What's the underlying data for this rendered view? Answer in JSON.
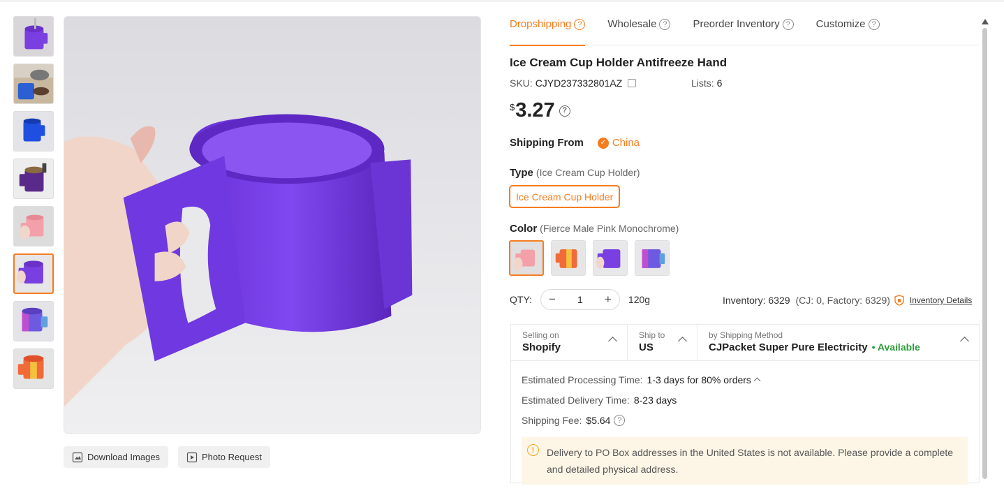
{
  "tabs": [
    {
      "label": "Dropshipping"
    },
    {
      "label": "Wholesale"
    },
    {
      "label": "Preorder Inventory"
    },
    {
      "label": "Customize"
    }
  ],
  "product": {
    "title": "Ice Cream Cup Holder Antifreeze Hand",
    "sku_label": "SKU:",
    "sku": "CJYD237332801AZ",
    "lists_label": "Lists:",
    "lists": "6",
    "currency": "$",
    "price": "3.27"
  },
  "shipping_from": {
    "label": "Shipping From",
    "value": "China"
  },
  "type": {
    "label": "Type",
    "selected_text": "(Ice Cream Cup Holder)",
    "option": "Ice Cream Cup Holder"
  },
  "color": {
    "label": "Color",
    "selected_text": "(Fierce Male Pink Monochrome)"
  },
  "qty": {
    "label": "QTY:",
    "value": "1",
    "weight": "120g"
  },
  "inventory": {
    "text": "Inventory: 6329",
    "detail": "(CJ: 0, Factory: 6329)",
    "link": "Inventory Details"
  },
  "shipping": {
    "selling_on_label": "Selling on",
    "selling_on": "Shopify",
    "ship_to_label": "Ship to",
    "ship_to": "US",
    "method_label": "by Shipping Method",
    "method": "CJPacket Super Pure Electricity",
    "availability": "• Available",
    "processing_label": "Estimated Processing Time:",
    "processing": "1-3 days for 80% orders",
    "delivery_label": "Estimated Delivery Time:",
    "delivery": "8-23 days",
    "fee_label": "Shipping Fee:",
    "fee": "$5.64",
    "notice": "Delivery to PO Box addresses in the United States is not available. Please provide a complete and detailed physical address."
  },
  "buttons": {
    "download": "Download Images",
    "photo_request": "Photo Request"
  },
  "colors": {
    "accent": "#f57c1f",
    "available": "#2e9d3a",
    "product_purple": "#7a3fe0"
  }
}
